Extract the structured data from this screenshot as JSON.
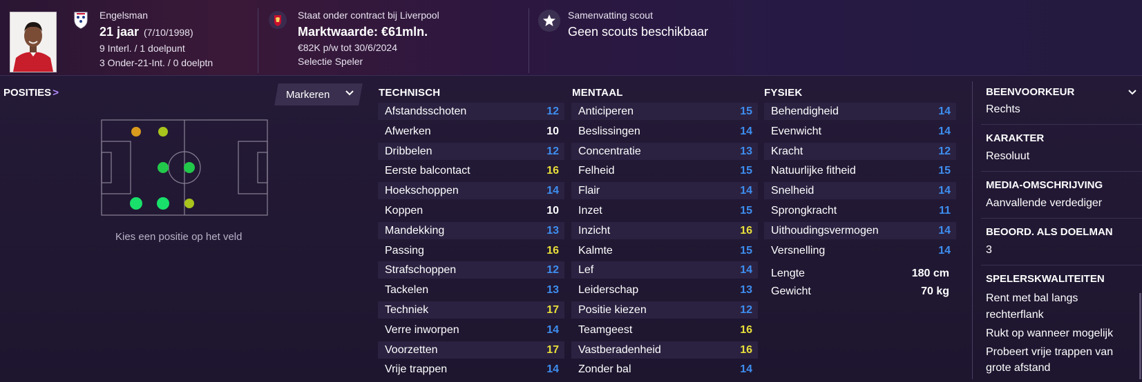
{
  "header": {
    "nationality": "Engelsman",
    "age": "21 jaar",
    "birthdate": "(7/10/1998)",
    "caps": "9 Interl. / 1 doelpunt",
    "u21_caps": "3 Onder-21-Int. / 0 doelptn",
    "contract": "Staat onder contract bij Liverpool",
    "market_value": "Marktwaarde: €61mln.",
    "wage": "€82K p/w tot 30/6/2024",
    "squad_status": "Selectie Speler",
    "scout_title": "Samenvatting scout",
    "scout_text": "Geen scouts beschikbaar"
  },
  "positions": {
    "label": "POSITIES",
    "chevron": ">",
    "mark_button": "Markeren",
    "caption": "Kies een positie op het veld",
    "dot_colors": {
      "natural": "#19e06a",
      "accomplished": "#22c84a",
      "unconvincing": "#a8c41d",
      "awkward": "#d99a1d"
    }
  },
  "technical": {
    "title": "TECHNISCH",
    "items": [
      {
        "name": "Afstandsschoten",
        "value": "12",
        "tone": "blue"
      },
      {
        "name": "Afwerken",
        "value": "10",
        "tone": "white"
      },
      {
        "name": "Dribbelen",
        "value": "12",
        "tone": "blue"
      },
      {
        "name": "Eerste balcontact",
        "value": "16",
        "tone": "yellow"
      },
      {
        "name": "Hoekschoppen",
        "value": "14",
        "tone": "blue"
      },
      {
        "name": "Koppen",
        "value": "10",
        "tone": "white"
      },
      {
        "name": "Mandekking",
        "value": "13",
        "tone": "blue"
      },
      {
        "name": "Passing",
        "value": "16",
        "tone": "yellow"
      },
      {
        "name": "Strafschoppen",
        "value": "12",
        "tone": "blue"
      },
      {
        "name": "Tackelen",
        "value": "13",
        "tone": "blue"
      },
      {
        "name": "Techniek",
        "value": "17",
        "tone": "yellow"
      },
      {
        "name": "Verre inworpen",
        "value": "14",
        "tone": "blue"
      },
      {
        "name": "Voorzetten",
        "value": "17",
        "tone": "yellow"
      },
      {
        "name": "Vrije trappen",
        "value": "14",
        "tone": "blue"
      }
    ]
  },
  "mental": {
    "title": "MENTAAL",
    "items": [
      {
        "name": "Anticiperen",
        "value": "15",
        "tone": "blue"
      },
      {
        "name": "Beslissingen",
        "value": "14",
        "tone": "blue"
      },
      {
        "name": "Concentratie",
        "value": "13",
        "tone": "blue"
      },
      {
        "name": "Felheid",
        "value": "15",
        "tone": "blue"
      },
      {
        "name": "Flair",
        "value": "14",
        "tone": "blue"
      },
      {
        "name": "Inzet",
        "value": "15",
        "tone": "blue"
      },
      {
        "name": "Inzicht",
        "value": "16",
        "tone": "yellow"
      },
      {
        "name": "Kalmte",
        "value": "15",
        "tone": "blue"
      },
      {
        "name": "Lef",
        "value": "14",
        "tone": "blue"
      },
      {
        "name": "Leiderschap",
        "value": "13",
        "tone": "blue"
      },
      {
        "name": "Positie kiezen",
        "value": "12",
        "tone": "blue"
      },
      {
        "name": "Teamgeest",
        "value": "16",
        "tone": "yellow"
      },
      {
        "name": "Vastberadenheid",
        "value": "16",
        "tone": "yellow"
      },
      {
        "name": "Zonder bal",
        "value": "14",
        "tone": "blue"
      }
    ]
  },
  "physical": {
    "title": "FYSIEK",
    "items": [
      {
        "name": "Behendigheid",
        "value": "14",
        "tone": "blue"
      },
      {
        "name": "Evenwicht",
        "value": "14",
        "tone": "blue"
      },
      {
        "name": "Kracht",
        "value": "12",
        "tone": "blue"
      },
      {
        "name": "Natuurlijke fitheid",
        "value": "15",
        "tone": "blue"
      },
      {
        "name": "Snelheid",
        "value": "14",
        "tone": "blue"
      },
      {
        "name": "Sprongkracht",
        "value": "11",
        "tone": "blue"
      },
      {
        "name": "Uithoudingsvermogen",
        "value": "14",
        "tone": "blue"
      },
      {
        "name": "Versnelling",
        "value": "14",
        "tone": "blue"
      }
    ],
    "height_label": "Lengte",
    "height_value": "180 cm",
    "weight_label": "Gewicht",
    "weight_value": "70 kg"
  },
  "info": {
    "foot_title": "BEENVOORKEUR",
    "foot_value": "Rechts",
    "personality_title": "KARAKTER",
    "personality_value": "Resoluut",
    "media_title": "MEDIA-OMSCHRIJVING",
    "media_value": "Aanvallende verdediger",
    "gk_title": "BEOORD. ALS DOELMAN",
    "gk_value": "3",
    "traits_title": "SPELERSKWALITEITEN",
    "traits": [
      "Rent met bal langs",
      "rechterflank",
      "Rukt op wanneer mogelijk",
      "Probeert vrije trappen van",
      "grote afstand"
    ]
  },
  "colors": {
    "blue": "#3e8ef0",
    "white": "#ffffff",
    "yellow": "#e9df3a",
    "background": "#1d1530"
  }
}
